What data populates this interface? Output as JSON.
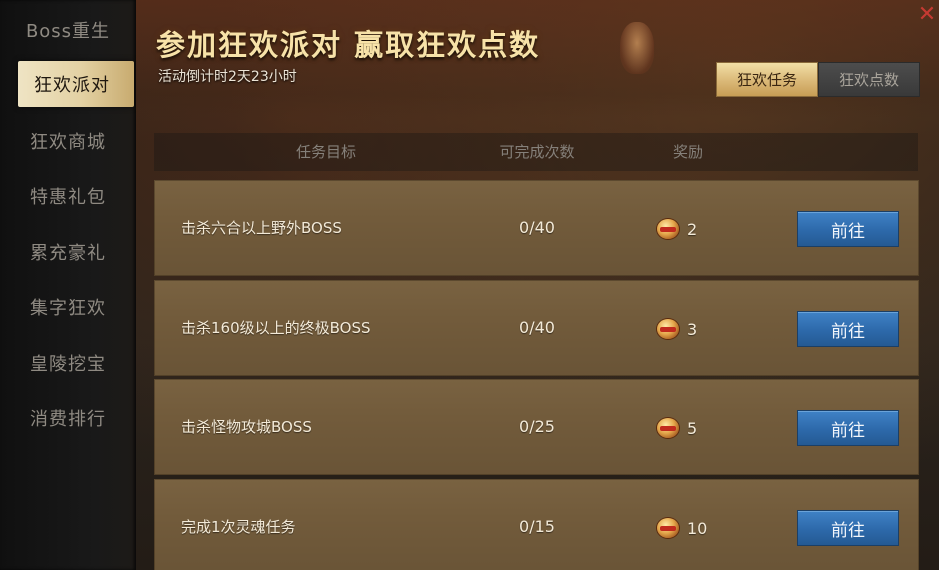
{
  "sidebar": {
    "items": [
      {
        "label": "Boss重生"
      },
      {
        "label": "狂欢派对"
      },
      {
        "label": "狂欢商城"
      },
      {
        "label": "特惠礼包"
      },
      {
        "label": "累充豪礼"
      },
      {
        "label": "集字狂欢"
      },
      {
        "label": "皇陵挖宝"
      },
      {
        "label": "消费排行"
      }
    ],
    "active_index": 1
  },
  "header": {
    "title": "参加狂欢派对 赢取狂欢点数",
    "countdown": "活动倒计时2天23小时",
    "close_symbol": "✕"
  },
  "tabs": [
    {
      "label": "狂欢任务",
      "active": true
    },
    {
      "label": "狂欢点数",
      "active": false
    }
  ],
  "table": {
    "columns": [
      "任务目标",
      "可完成次数",
      "奖励"
    ],
    "rows": [
      {
        "target": "击杀六合以上野外BOSS",
        "count": "0/40",
        "reward": "2",
        "button": "前往"
      },
      {
        "target": "击杀160级以上的终极BOSS",
        "count": "0/40",
        "reward": "3",
        "button": "前往"
      },
      {
        "target": "击杀怪物攻城BOSS",
        "count": "0/25",
        "reward": "5",
        "button": "前往"
      },
      {
        "target": "完成1次灵魂任务",
        "count": "0/15",
        "reward": "10",
        "button": "前往"
      }
    ]
  },
  "colors": {
    "accent_gold": "#f7e2a8",
    "row_bg": "#725b3b",
    "button_blue": "#2d69aa",
    "close_red": "#c63a32"
  }
}
